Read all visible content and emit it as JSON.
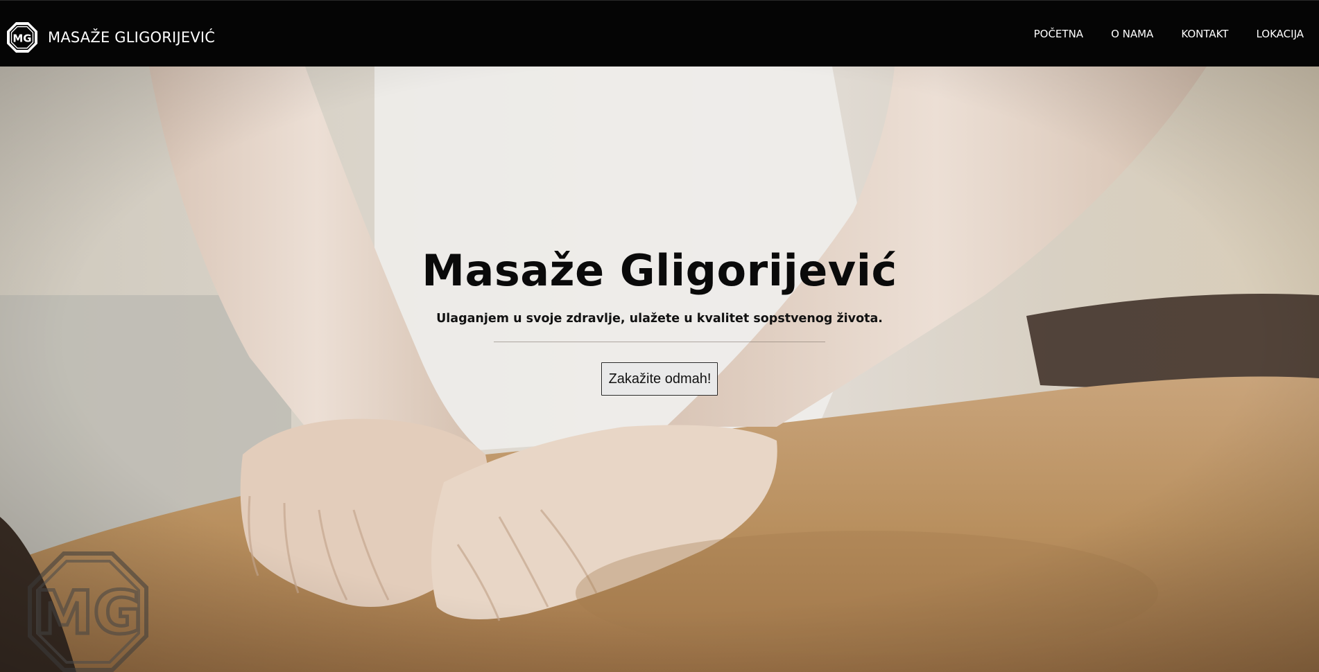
{
  "navbar": {
    "brand": {
      "logo_icon": "mg-octagon-logo-icon",
      "logo_text": "MG",
      "name": "MASAŽE GLIGORIJEVIĆ"
    },
    "links": [
      {
        "label": "POČETNA"
      },
      {
        "label": "O NAMA"
      },
      {
        "label": "KONTAKT"
      },
      {
        "label": "LOKACIJA"
      }
    ]
  },
  "hero": {
    "background": "massage-hands-on-back-photo",
    "title": "Masaže Gligorijević",
    "subtitle": "Ulaganjem u svoje zdravlje, ulažete u kvalitet sopstvenog života.",
    "button_label": "Zakažite odmah!",
    "watermark_icon": "mg-octagon-watermark-icon",
    "watermark_text": "MG"
  },
  "colors": {
    "navbar_bg": "#050505",
    "nav_text": "#ffffff",
    "title_text": "#0a0a0a",
    "button_bg": "#e9e9e9"
  }
}
